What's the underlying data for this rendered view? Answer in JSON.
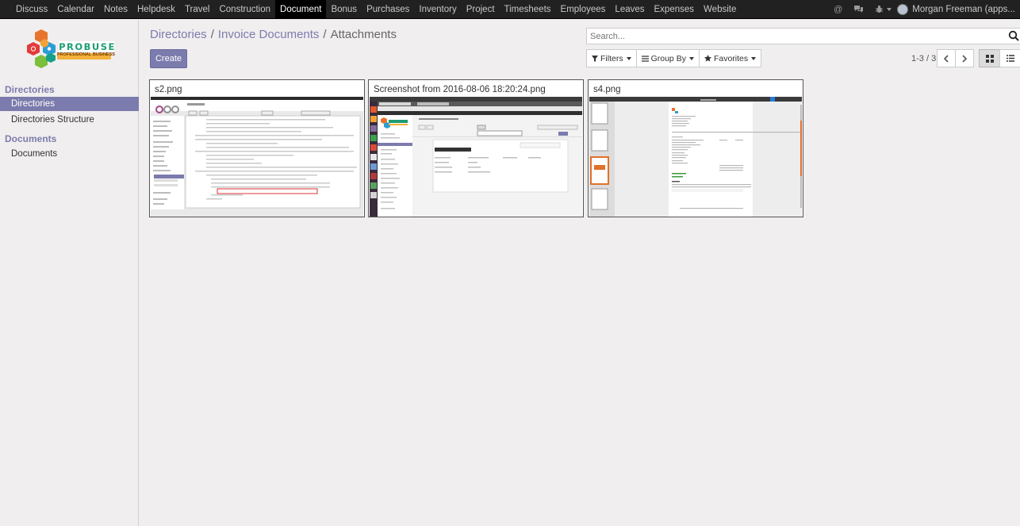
{
  "topbar": {
    "menu": [
      "Discuss",
      "Calendar",
      "Notes",
      "Helpdesk",
      "Travel",
      "Construction",
      "Document",
      "Bonus",
      "Purchases",
      "Inventory",
      "Project",
      "Timesheets",
      "Employees",
      "Leaves",
      "Expenses",
      "Website"
    ],
    "active": "Document",
    "user": "Morgan Freeman (apps..."
  },
  "logo": {
    "name": "PROBUSE",
    "tagline": "PROFESSIONAL BUSINESS"
  },
  "sidebar": {
    "sections": [
      {
        "title": "Directories",
        "items": [
          {
            "label": "Directories",
            "active": true
          },
          {
            "label": "Directories Structure",
            "active": false
          }
        ]
      },
      {
        "title": "Documents",
        "items": [
          {
            "label": "Documents",
            "active": false
          }
        ]
      }
    ]
  },
  "breadcrumb": {
    "items": [
      "Directories",
      "Invoice Documents"
    ],
    "current": "Attachments",
    "separator": "/"
  },
  "buttons": {
    "create": "Create"
  },
  "search": {
    "placeholder": "Search..."
  },
  "filters": {
    "filters": "Filters",
    "group_by": "Group By",
    "favorites": "Favorites"
  },
  "pager": {
    "value": "1-3 / 3"
  },
  "kanban": {
    "cards": [
      {
        "title": "s2.png",
        "thumb": "code-editor-screenshot"
      },
      {
        "title": "Screenshot from 2016-08-06 18:20:24.png",
        "thumb": "payment-form-screenshot"
      },
      {
        "title": "s4.png",
        "thumb": "pdf-invoice-screenshot"
      }
    ]
  },
  "colors": {
    "brand": "#7c7bad",
    "topbar": "#212121",
    "background": "#f0eeee"
  }
}
